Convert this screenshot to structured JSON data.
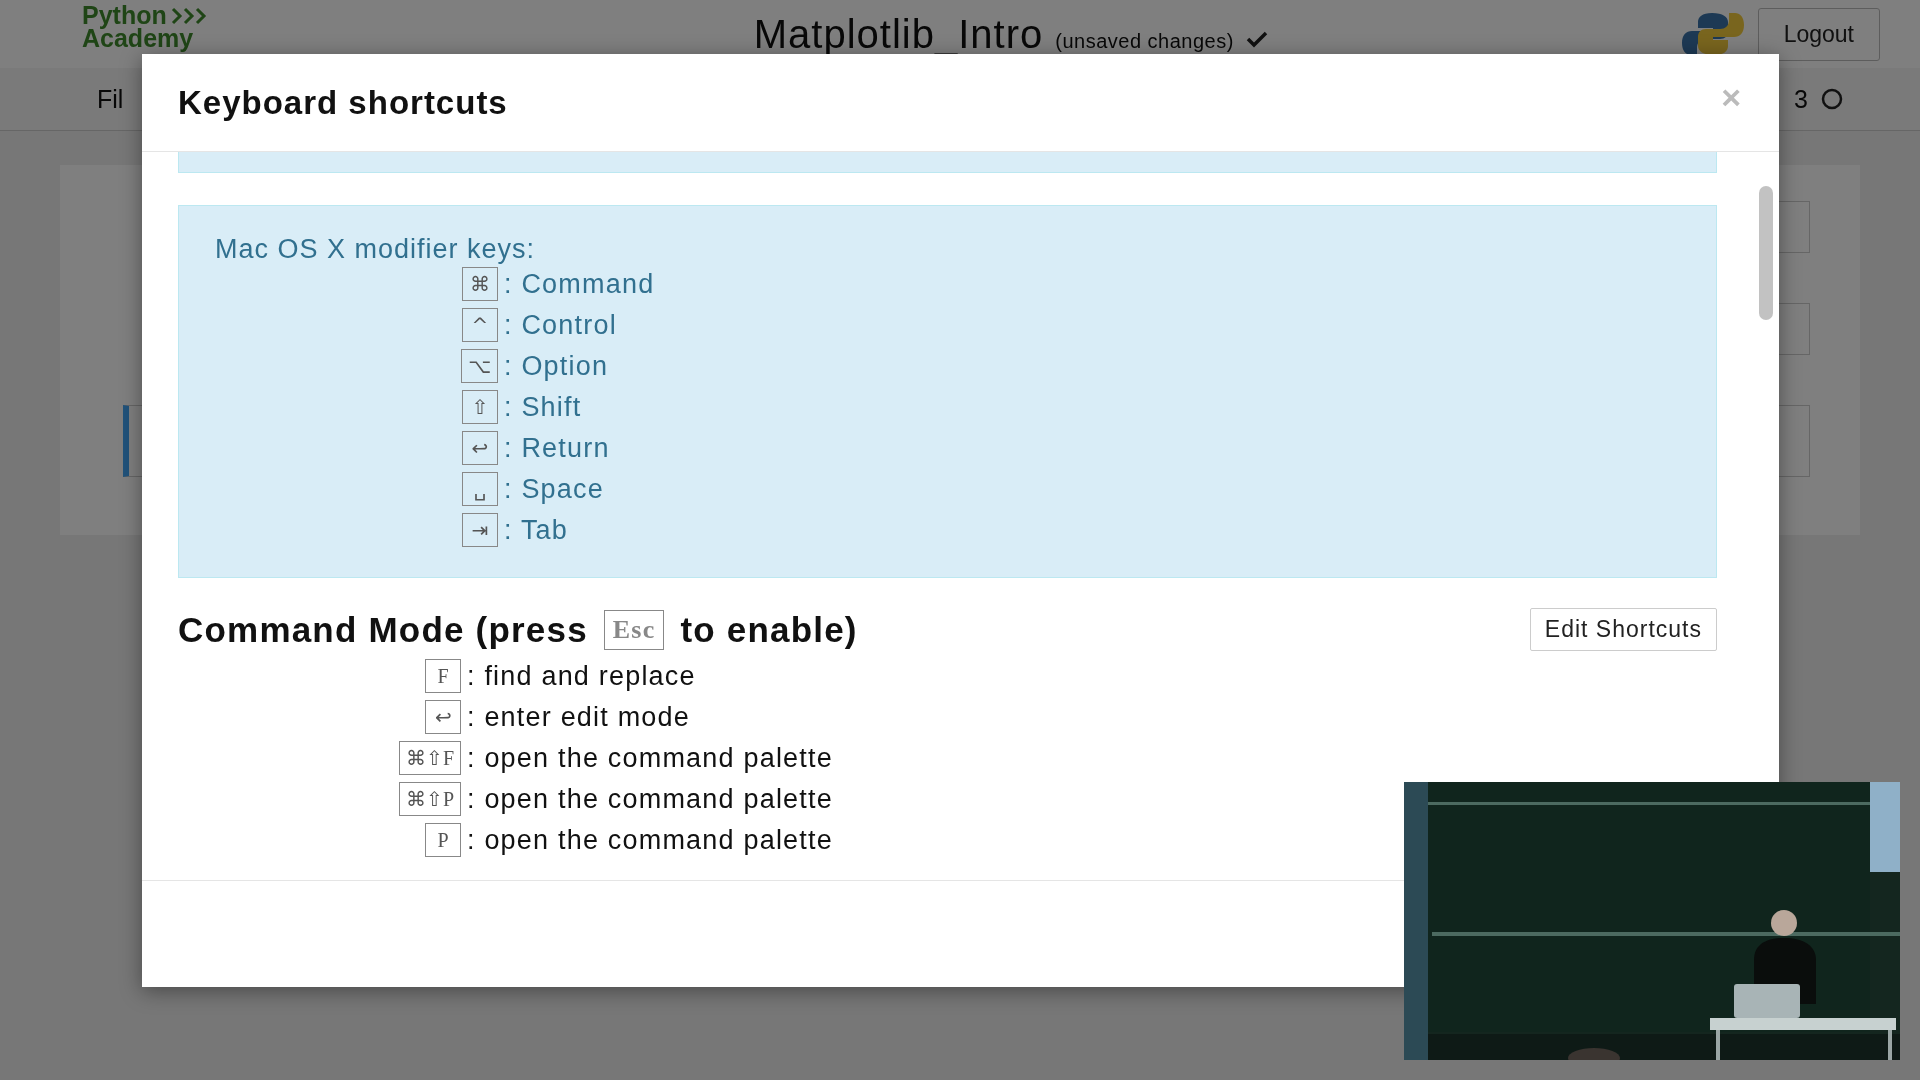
{
  "header": {
    "logo": {
      "line_1": "Python",
      "line_2": "Academy"
    },
    "notebook_title": "Matplotlib_Intro",
    "save_status": "(unsaved changes)",
    "logout_button": "Logout"
  },
  "menu_bar": {
    "items": [
      "Fil"
    ],
    "kernel_indicator": "3"
  },
  "dialog": {
    "title": "Keyboard shortcuts",
    "close": "×",
    "modifier_box": {
      "heading": "Mac OS X modifier keys:",
      "keys": [
        {
          "key": "⌘",
          "label": ": Command"
        },
        {
          "key": "^",
          "label": ": Control"
        },
        {
          "key": "⌥",
          "label": ": Option"
        },
        {
          "key": "⇧",
          "label": ": Shift"
        },
        {
          "key": "↩",
          "label": ": Return"
        },
        {
          "key": "␣",
          "label": ": Space"
        },
        {
          "key": "⇥",
          "label": ": Tab"
        }
      ]
    },
    "command_mode": {
      "heading_before": "Command Mode (press",
      "key": "Esc",
      "heading_after": "to enable)",
      "edit_button": "Edit Shortcuts",
      "shortcuts": [
        {
          "key": "F",
          "description": ": find and replace"
        },
        {
          "key": "↩",
          "description": ": enter edit mode"
        },
        {
          "key": "⌘⇧F",
          "description": ": open the command palette"
        },
        {
          "key": "⌘⇧P",
          "description": ": open the command palette"
        },
        {
          "key": "P",
          "description": ": open the command palette"
        }
      ]
    }
  }
}
